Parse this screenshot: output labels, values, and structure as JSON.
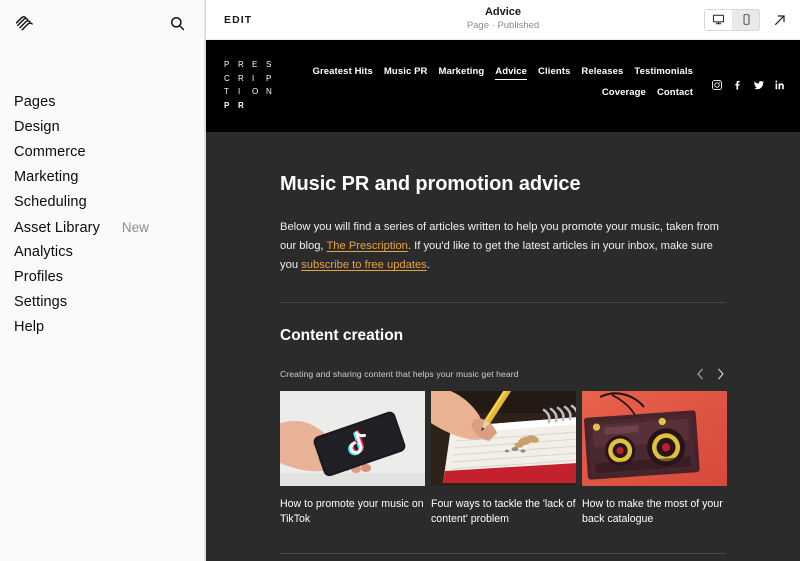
{
  "sidebar": {
    "logo_icon": "squarespace-logo",
    "search_icon": "search-icon",
    "items": [
      {
        "label": "Pages",
        "badge": ""
      },
      {
        "label": "Design",
        "badge": ""
      },
      {
        "label": "Commerce",
        "badge": ""
      },
      {
        "label": "Marketing",
        "badge": ""
      },
      {
        "label": "Scheduling",
        "badge": ""
      },
      {
        "label": "Asset Library",
        "badge": "New"
      },
      {
        "label": "Analytics",
        "badge": ""
      },
      {
        "label": "Profiles",
        "badge": ""
      },
      {
        "label": "Settings",
        "badge": ""
      },
      {
        "label": "Help",
        "badge": ""
      }
    ]
  },
  "editbar": {
    "edit_label": "EDIT",
    "page_title": "Advice",
    "page_status": "Page · Published",
    "desktop_icon": "desktop-icon",
    "mobile_icon": "mobile-icon",
    "external_icon": "external-link-icon",
    "active_device": "mobile"
  },
  "site_header": {
    "brand_rows": [
      {
        "letters": [
          "P",
          "R",
          "E",
          "S"
        ],
        "bold": false
      },
      {
        "letters": [
          "C",
          "R",
          "I",
          "P"
        ],
        "bold": false
      },
      {
        "letters": [
          "T",
          "I",
          "O",
          "N"
        ],
        "bold": false
      },
      {
        "letters": [
          "P",
          "R"
        ],
        "bold": true
      }
    ],
    "nav": [
      {
        "label": "Greatest Hits",
        "active": false
      },
      {
        "label": "Music PR",
        "active": false
      },
      {
        "label": "Marketing",
        "active": false
      },
      {
        "label": "Advice",
        "active": true
      },
      {
        "label": "Clients",
        "active": false
      },
      {
        "label": "Releases",
        "active": false
      },
      {
        "label": "Testimonials",
        "active": false
      },
      {
        "label": "Coverage",
        "active": false
      },
      {
        "label": "Contact",
        "active": false
      }
    ],
    "socials": [
      {
        "icon": "instagram-icon"
      },
      {
        "icon": "facebook-icon"
      },
      {
        "icon": "twitter-icon"
      },
      {
        "icon": "linkedin-icon"
      }
    ]
  },
  "page": {
    "hero_heading": "Music PR and promotion advice",
    "intro": {
      "part1": "Below you will find a series of articles written to help you promote your music, taken from our blog, ",
      "link1": "The Prescription",
      "part2": ". If you'd like to get the latest articles in your inbox, make sure you ",
      "link2": "subscribe to free updates",
      "part3": "."
    },
    "section_heading": "Content creation",
    "section_subtitle": "Creating and sharing content that helps your music get heard",
    "prev_icon": "chevron-left-icon",
    "next_icon": "chevron-right-icon",
    "cards": [
      {
        "title": "How to promote your music on TikTok",
        "image": "hand-holding-phone-tiktok"
      },
      {
        "title": "Four ways to tackle the 'lack of content' problem",
        "image": "hand-writing-notebook-pencil"
      },
      {
        "title": "How to make the most of your back catalogue",
        "image": "cassette-tape-red-background"
      }
    ]
  },
  "colors": {
    "accent_link": "#e8a33d",
    "page_bg": "#2b2b2b",
    "header_bg": "#000000",
    "sidebar_bg": "#fafafa"
  }
}
